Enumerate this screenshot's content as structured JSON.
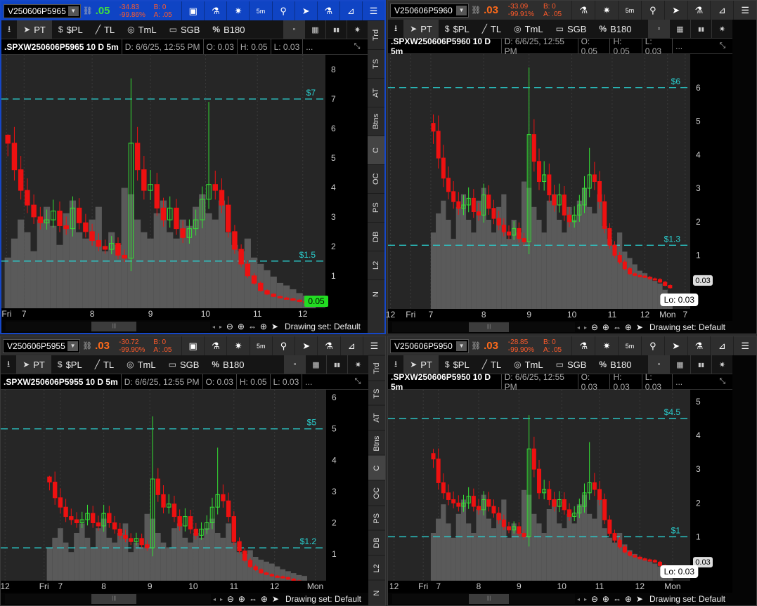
{
  "common": {
    "toolbar": {
      "pin": "⭳",
      "pt": "PT",
      "spl": "$PL",
      "tl": "TL",
      "tml": "TmL",
      "sgb": "SGB",
      "b180": "B180"
    },
    "side_tabs": [
      "Trd",
      "TS",
      "AT",
      "Btns",
      "C",
      "OC",
      "PS",
      "DB",
      "L2",
      "N"
    ],
    "active_side_tab": "C",
    "drawing_set": "Drawing set: Default",
    "ellipsis": "...",
    "colors": {
      "up": "#35e035",
      "down": "#ee1111",
      "level": "#2ad0d0",
      "volume": "#5a5a5a",
      "bg": "#262626",
      "grid": "#3a3a3a"
    }
  },
  "panels": [
    {
      "symbol": "V250606P5965",
      "last": ".05",
      "last_dir": "up",
      "change": "-34.83",
      "change_pct": "-99.86%",
      "bid": "B: 0",
      "ask": "A: .05",
      "title": ".SPXW250606P5965 10 D 5m",
      "date": "D: 6/6/25, 12:55 PM",
      "open": "O: 0.03",
      "high": "H: 0.05",
      "low": "L: 0.03",
      "chart_data": {
        "type": "candlestick",
        "ylim": [
          -0.1,
          8.5
        ],
        "yticks": [
          "1",
          "2",
          "3",
          "4",
          "5",
          "6",
          "7",
          "8"
        ],
        "slots": 50,
        "first_slot": 1,
        "xticks": [
          {
            "label": "Fri",
            "at": 0.8
          },
          {
            "label": "7",
            "at": 3.5
          },
          {
            "label": "8",
            "at": 14
          },
          {
            "label": "9",
            "at": 23
          },
          {
            "label": "10",
            "at": 31.5
          },
          {
            "label": "11",
            "at": 39.5
          },
          {
            "label": "12",
            "at": 46.5
          }
        ],
        "levels": [
          {
            "value": 7,
            "label": "$7"
          },
          {
            "value": 1.5,
            "label": "$1.5"
          }
        ],
        "last_tag": "0.05",
        "last_tag_style": "green",
        "lo_label": "",
        "closes": [
          5.5,
          4.6,
          3.9,
          3.4,
          3.0,
          2.8,
          2.9,
          3.2,
          2.7,
          2.6,
          3.3,
          2.8,
          2.5,
          2.2,
          2.0,
          1.9,
          2.1,
          1.7,
          1.6,
          5.5,
          4.6,
          3.9,
          4.1,
          3.3,
          2.9,
          3.3,
          2.6,
          2.3,
          2.6,
          2.9,
          3.6,
          4.1,
          3.9,
          3.4,
          2.5,
          1.9,
          1.4,
          1.0,
          0.75,
          0.5,
          0.38,
          0.3,
          0.25,
          0.22,
          0.18,
          0.13,
          0.08,
          0.05
        ],
        "spikes": {
          "0": 5.8,
          "19": 7.7,
          "31": 6.9
        },
        "volume": [
          40,
          55,
          70,
          60,
          45,
          70,
          80,
          65,
          50,
          75,
          85,
          60,
          55,
          70,
          80,
          45,
          60,
          50,
          95,
          90,
          70,
          60,
          55,
          75,
          85,
          60,
          55,
          70,
          65,
          80,
          90,
          75,
          70,
          85,
          60,
          50,
          45,
          55,
          40,
          35,
          30,
          25,
          20,
          18,
          15,
          12,
          10,
          8
        ]
      }
    },
    {
      "symbol": "V250606P5960",
      "last": ".03",
      "last_dir": "down",
      "change": "-33.09",
      "change_pct": "-99.91%",
      "bid": "B: 0",
      "ask": "A: .05",
      "title": ".SPXW250606P5960 10 D 5m",
      "date": "D: 6/6/25, 12:55 PM",
      "open": "O: 0.05",
      "high": "H: 0.05",
      "low": "L: 0.03",
      "chart_data": {
        "type": "candlestick",
        "ylim": [
          -0.6,
          7
        ],
        "yticks": [
          "1",
          "2",
          "3",
          "4",
          "5",
          "6"
        ],
        "slots": 60,
        "first_slot": 9,
        "xticks": [
          {
            "label": "12",
            "at": 0.5
          },
          {
            "label": "Fri",
            "at": 4.5
          },
          {
            "label": "7",
            "at": 8.5
          },
          {
            "label": "8",
            "at": 19
          },
          {
            "label": "9",
            "at": 28
          },
          {
            "label": "10",
            "at": 36.5
          },
          {
            "label": "11",
            "at": 44.5
          },
          {
            "label": "12",
            "at": 51
          },
          {
            "label": "Mon",
            "at": 55.5
          },
          {
            "label": "7",
            "at": 59
          }
        ],
        "levels": [
          {
            "value": 6,
            "label": "$6"
          },
          {
            "value": 1.3,
            "label": "$1.3"
          }
        ],
        "last_tag": "0.03",
        "last_tag_style": "box",
        "lo_label": "Lo: 0.03",
        "closes": [
          4.7,
          3.9,
          3.3,
          2.9,
          2.6,
          2.4,
          2.5,
          2.7,
          2.3,
          2.2,
          2.8,
          2.4,
          2.1,
          1.9,
          1.7,
          1.6,
          1.8,
          1.5,
          1.4,
          4.6,
          3.8,
          3.2,
          3.4,
          2.8,
          2.5,
          2.8,
          2.2,
          2.0,
          2.2,
          2.5,
          3.0,
          3.4,
          3.2,
          2.6,
          1.8,
          1.3,
          1.0,
          0.8,
          0.6,
          0.45,
          0.4,
          0.38,
          0.35,
          0.3,
          0.28,
          0.2,
          0.1,
          0.03
        ],
        "spikes": {
          "0": 5.2,
          "19": 6.6,
          "31": 4.2
        },
        "volume": [
          60,
          75,
          85,
          70,
          55,
          80,
          90,
          70,
          60,
          85,
          95,
          70,
          60,
          80,
          90,
          55,
          70,
          60,
          100,
          95,
          80,
          70,
          60,
          85,
          90,
          70,
          60,
          80,
          70,
          85,
          95,
          80,
          75,
          90,
          65,
          55,
          50,
          60,
          45,
          40,
          35,
          30,
          28,
          25,
          22,
          20,
          15,
          10
        ]
      }
    },
    {
      "symbol": "V250606P5955",
      "last": ".03",
      "last_dir": "down",
      "change": "-30.72",
      "change_pct": "-99.90%",
      "bid": "B: 0",
      "ask": "A: .05",
      "title": ".SPXW250606P5955 10 D 5m",
      "date": "D: 6/6/25, 12:55 PM",
      "open": "O: 0.03",
      "high": "H: 0.05",
      "low": "L: 0.03",
      "chart_data": {
        "type": "candlestick",
        "ylim": [
          0.15,
          6.25
        ],
        "yticks": [
          "1",
          "2",
          "3",
          "4",
          "5",
          "6"
        ],
        "slots": 60,
        "first_slot": 9,
        "xticks": [
          {
            "label": "12",
            "at": 0.8
          },
          {
            "label": "Fri",
            "at": 8
          },
          {
            "label": "7",
            "at": 11
          },
          {
            "label": "8",
            "at": 19
          },
          {
            "label": "9",
            "at": 27.5
          },
          {
            "label": "10",
            "at": 35.5
          },
          {
            "label": "11",
            "at": 43
          },
          {
            "label": "12",
            "at": 50.5
          },
          {
            "label": "Mon",
            "at": 58
          }
        ],
        "levels": [
          {
            "value": 5,
            "label": "$5"
          },
          {
            "value": 1.2,
            "label": "$1.2"
          }
        ],
        "last_tag": "",
        "last_tag_style": "none",
        "lo_label": "",
        "closes": [
          3.3,
          2.8,
          2.5,
          2.2,
          2.1,
          2.0,
          2.1,
          2.3,
          2.0,
          1.9,
          2.3,
          2.0,
          1.8,
          1.6,
          1.5,
          1.4,
          1.5,
          1.3,
          1.2,
          3.4,
          2.9,
          2.5,
          2.6,
          2.2,
          1.9,
          2.2,
          1.8,
          1.6,
          1.8,
          2.0,
          2.5,
          2.9,
          2.7,
          2.2,
          1.4,
          1.1,
          0.8,
          0.6,
          0.5,
          0.4,
          0.35,
          0.3,
          0.28,
          0.25,
          0.2,
          0.15,
          0.1,
          0.05
        ],
        "spikes": {
          "0": 3.5,
          "19": 5.4,
          "31": 4.4
        },
        "volume": [
          35,
          45,
          55,
          40,
          30,
          50,
          60,
          45,
          35,
          55,
          65,
          45,
          40,
          50,
          60,
          30,
          40,
          35,
          70,
          65,
          50,
          40,
          35,
          55,
          60,
          45,
          40,
          50,
          45,
          55,
          65,
          50,
          45,
          60,
          40,
          30,
          28,
          32,
          25,
          22,
          20,
          18,
          15,
          12,
          10,
          8,
          6,
          5
        ]
      }
    },
    {
      "symbol": "V250606P5950",
      "last": ".03",
      "last_dir": "down",
      "change": "-28.85",
      "change_pct": "-99.90%",
      "bid": "B: 0",
      "ask": "A: .05",
      "title": ".SPXW250606P5950 10 D 5m",
      "date": "D: 6/6/25, 12:55 PM",
      "open": "O: 0.03",
      "high": "H: 0.03",
      "low": "L: 0.03",
      "chart_data": {
        "type": "candlestick",
        "ylim": [
          -0.3,
          5.35
        ],
        "yticks": [
          "1",
          "2",
          "3",
          "4",
          "5"
        ],
        "slots": 60,
        "first_slot": 9,
        "xticks": [
          {
            "label": "12",
            "at": 1.2
          },
          {
            "label": "Fri",
            "at": 7
          },
          {
            "label": "7",
            "at": 10
          },
          {
            "label": "8",
            "at": 18
          },
          {
            "label": "9",
            "at": 26
          },
          {
            "label": "10",
            "at": 34.5
          },
          {
            "label": "11",
            "at": 42
          },
          {
            "label": "12",
            "at": 50
          },
          {
            "label": "Mon",
            "at": 56.5
          }
        ],
        "levels": [
          {
            "value": 4.5,
            "label": "$4.5"
          },
          {
            "value": 1,
            "label": "$1"
          }
        ],
        "last_tag": "0.03",
        "last_tag_style": "box",
        "lo_label": "Lo: 0.03",
        "closes": [
          3.3,
          2.6,
          2.3,
          2.1,
          2.0,
          1.9,
          2.0,
          2.2,
          1.9,
          1.8,
          2.1,
          1.9,
          1.7,
          1.5,
          1.3,
          1.2,
          1.3,
          1.1,
          1.0,
          3.6,
          3.0,
          2.3,
          2.4,
          2.1,
          1.9,
          2.1,
          1.8,
          1.6,
          1.7,
          1.9,
          2.3,
          2.6,
          2.4,
          2.1,
          1.5,
          1.1,
          0.9,
          0.7,
          0.55,
          0.45,
          0.4,
          0.35,
          0.32,
          0.3,
          0.25,
          0.15,
          0.08,
          0.03
        ],
        "spikes": {
          "0": 3.6,
          "19": 4.6,
          "31": 3.8
        },
        "volume": [
          50,
          65,
          80,
          60,
          45,
          70,
          85,
          60,
          50,
          75,
          90,
          65,
          55,
          70,
          85,
          45,
          60,
          50,
          95,
          90,
          70,
          60,
          50,
          75,
          85,
          60,
          55,
          70,
          60,
          80,
          90,
          70,
          65,
          85,
          55,
          45,
          40,
          50,
          38,
          32,
          28,
          25,
          22,
          20,
          18,
          15,
          12,
          8
        ]
      }
    }
  ]
}
